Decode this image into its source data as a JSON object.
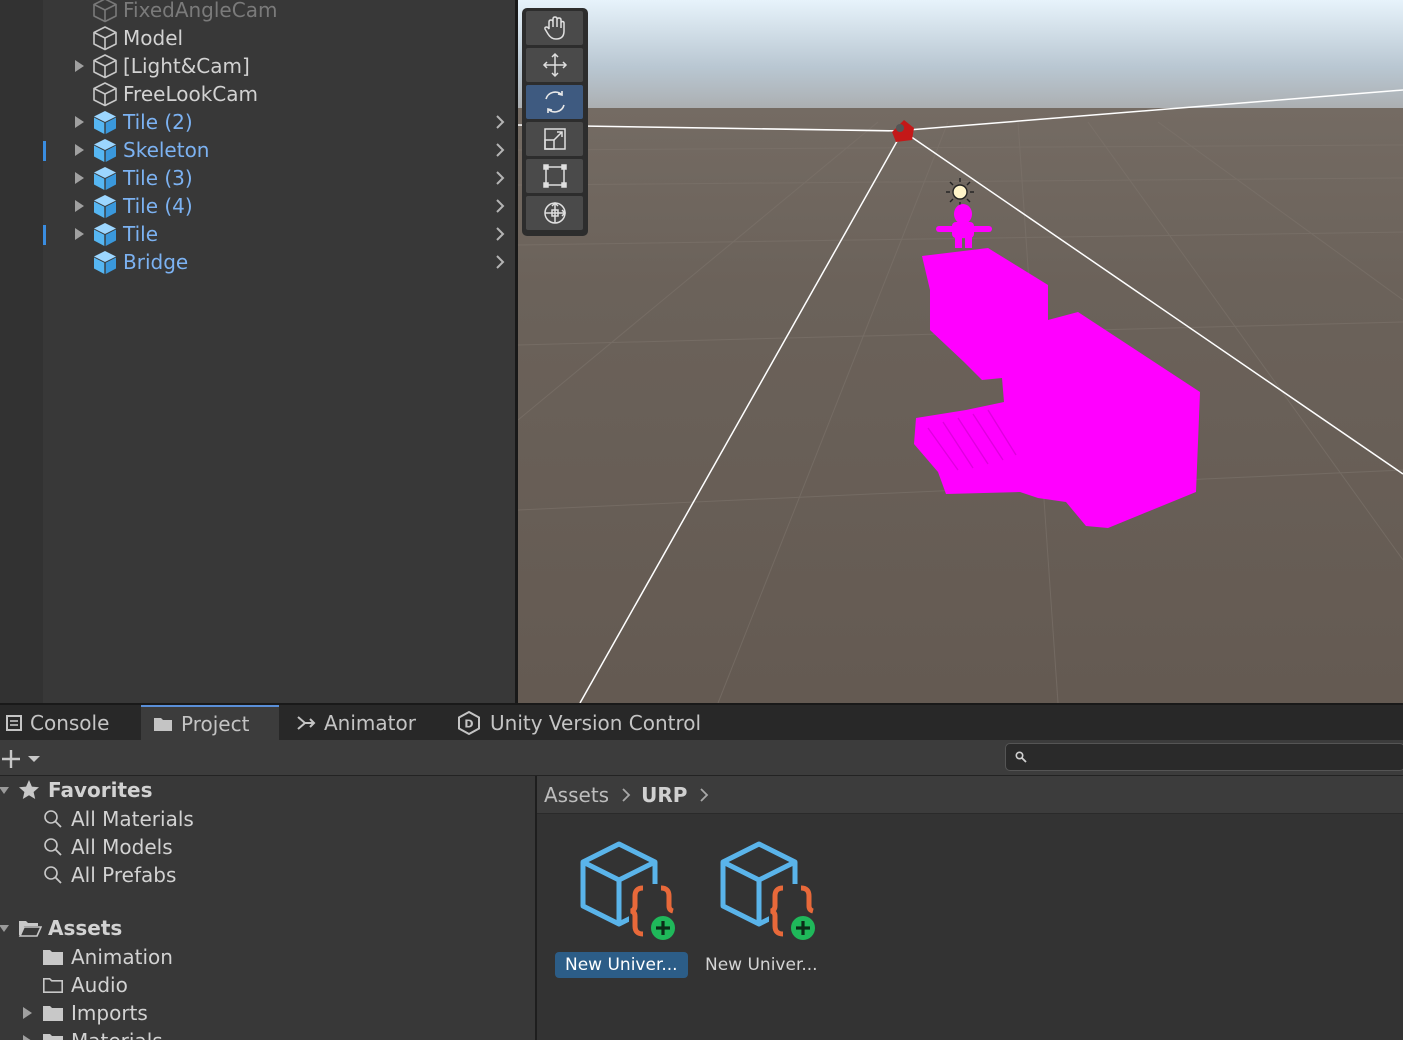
{
  "hierarchy": {
    "items": [
      {
        "label": "FixedAngleCam",
        "style": "dim",
        "icon": "gameobject-icon",
        "fold": false,
        "chevron": false,
        "marked": false
      },
      {
        "label": "Model",
        "style": "plain",
        "icon": "gameobject-icon",
        "fold": false,
        "chevron": false,
        "marked": false
      },
      {
        "label": "[Light&Cam]",
        "style": "plain",
        "icon": "gameobject-icon",
        "fold": true,
        "chevron": false,
        "marked": false
      },
      {
        "label": "FreeLookCam",
        "style": "plain",
        "icon": "gameobject-icon",
        "fold": false,
        "chevron": false,
        "marked": false
      },
      {
        "label": "Tile (2)",
        "style": "prefab",
        "icon": "prefab-icon",
        "fold": true,
        "chevron": true,
        "marked": false
      },
      {
        "label": "Skeleton",
        "style": "prefab",
        "icon": "prefab-icon",
        "fold": true,
        "chevron": true,
        "marked": true
      },
      {
        "label": "Tile (3)",
        "style": "prefab",
        "icon": "prefab-icon",
        "fold": true,
        "chevron": true,
        "marked": false
      },
      {
        "label": "Tile (4)",
        "style": "prefab",
        "icon": "prefab-icon",
        "fold": true,
        "chevron": true,
        "marked": false
      },
      {
        "label": "Tile",
        "style": "prefab",
        "icon": "prefab-icon",
        "fold": true,
        "chevron": true,
        "marked": true
      },
      {
        "label": "Bridge",
        "style": "prefab",
        "icon": "prefab-icon",
        "fold": false,
        "chevron": true,
        "marked": false
      }
    ]
  },
  "scene": {
    "tools": [
      {
        "name": "hand-tool-icon",
        "active": false
      },
      {
        "name": "move-tool-icon",
        "active": false
      },
      {
        "name": "rotate-tool-icon",
        "active": true
      },
      {
        "name": "scale-tool-icon",
        "active": false
      },
      {
        "name": "rect-tool-icon",
        "active": false
      },
      {
        "name": "transform-tool-icon",
        "active": false
      }
    ],
    "colors": {
      "ground": "#6a6159",
      "missing_material": "#ff00ff",
      "sky_top": "#dfeef8",
      "horizon": "#c9c9c9"
    }
  },
  "tabs": {
    "console": "Console",
    "project": "Project",
    "animator": "Animator",
    "uvc": "Unity Version Control"
  },
  "project": {
    "search_placeholder": "",
    "favorites": {
      "label": "Favorites",
      "items": [
        "All Materials",
        "All Models",
        "All Prefabs"
      ]
    },
    "assets": {
      "label": "Assets",
      "items": [
        {
          "label": "Animation",
          "fold": false,
          "icon": "folder-filled-icon"
        },
        {
          "label": "Audio",
          "fold": false,
          "icon": "folder-empty-icon"
        },
        {
          "label": "Imports",
          "fold": true,
          "icon": "folder-filled-icon"
        },
        {
          "label": "Materials",
          "fold": true,
          "icon": "folder-filled-icon"
        }
      ]
    },
    "breadcrumb": {
      "root": "Assets",
      "current": "URP"
    },
    "files": [
      {
        "label": "New Univer...",
        "selected": true
      },
      {
        "label": "New Univer...",
        "selected": false
      }
    ]
  }
}
